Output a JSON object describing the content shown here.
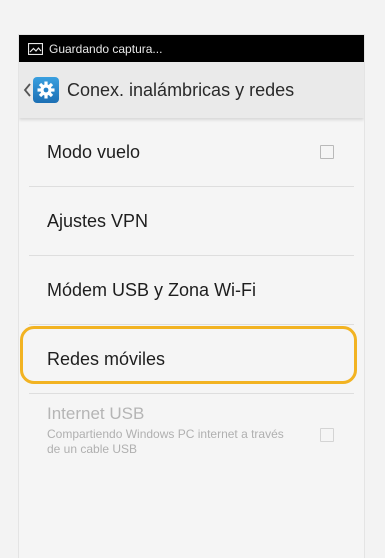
{
  "status_bar": {
    "notification_icon": "image-icon",
    "text": "Guardando captura..."
  },
  "action_bar": {
    "back_icon": "chevron-left-icon",
    "app_icon": "gear-icon",
    "title": "Conex. inalámbricas y redes"
  },
  "settings": [
    {
      "label": "Modo vuelo",
      "has_checkbox": true,
      "checked": false
    },
    {
      "label": "Ajustes VPN"
    },
    {
      "label": "Módem USB y Zona Wi-Fi"
    },
    {
      "label": "Redes móviles",
      "highlighted": true
    },
    {
      "label": "Internet USB",
      "summary": "Compartiendo Windows PC internet a través de un cable USB",
      "enabled": false,
      "has_checkbox": true,
      "checked": false
    }
  ],
  "colors": {
    "highlight": "#f2b322",
    "status_bar": "#000000",
    "action_bar": "#eaeaea"
  }
}
